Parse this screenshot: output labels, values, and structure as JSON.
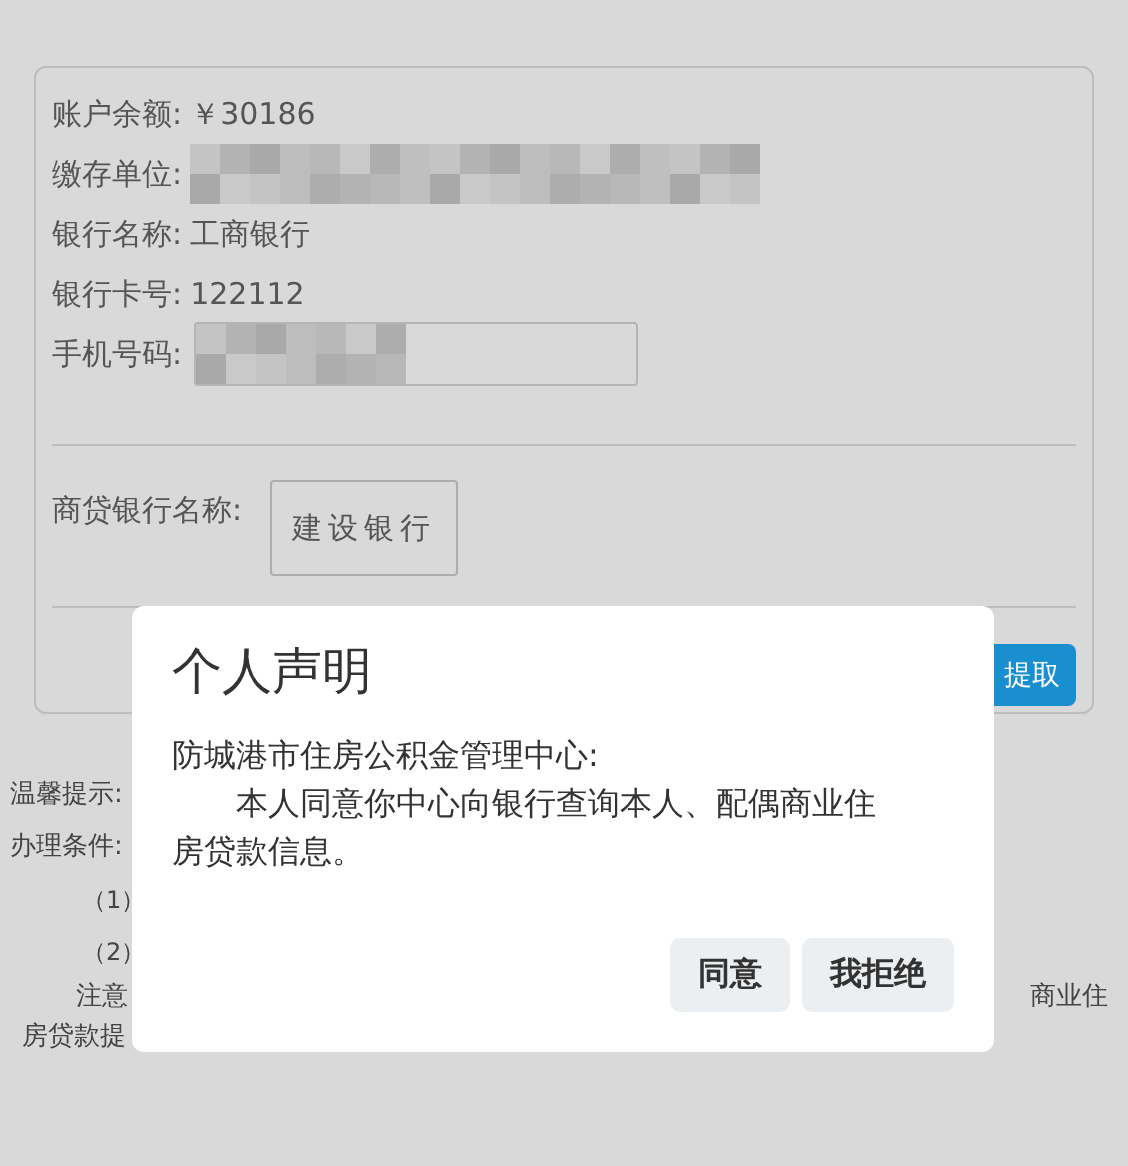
{
  "account": {
    "rows": [
      {
        "kind": "text",
        "label": "账户余额:",
        "value": "￥30186"
      },
      {
        "kind": "blurred",
        "label": "缴存单位:"
      },
      {
        "kind": "text",
        "label": "银行名称:",
        "value": "工商银行"
      },
      {
        "kind": "text",
        "label": "银行卡号:",
        "value": "122112"
      },
      {
        "kind": "field",
        "label": "手机号码:"
      }
    ],
    "loan_bank": {
      "label": "商贷银行名称:",
      "button": "建设银行"
    },
    "submit_button": "提取"
  },
  "tips": {
    "lines": [
      "温馨提示:",
      "办理条件:",
      "（1）",
      "（2）"
    ],
    "note_start": "注意",
    "note_end": "商业住",
    "last_line": "房贷款提"
  },
  "dialog": {
    "title": "个人声明",
    "addressee": "防城港市住房公积金管理中心:",
    "body": "本人同意你中心向银行查询本人、配偶商业住房贷款信息。",
    "buttons": [
      "同意",
      "我拒绝"
    ]
  }
}
